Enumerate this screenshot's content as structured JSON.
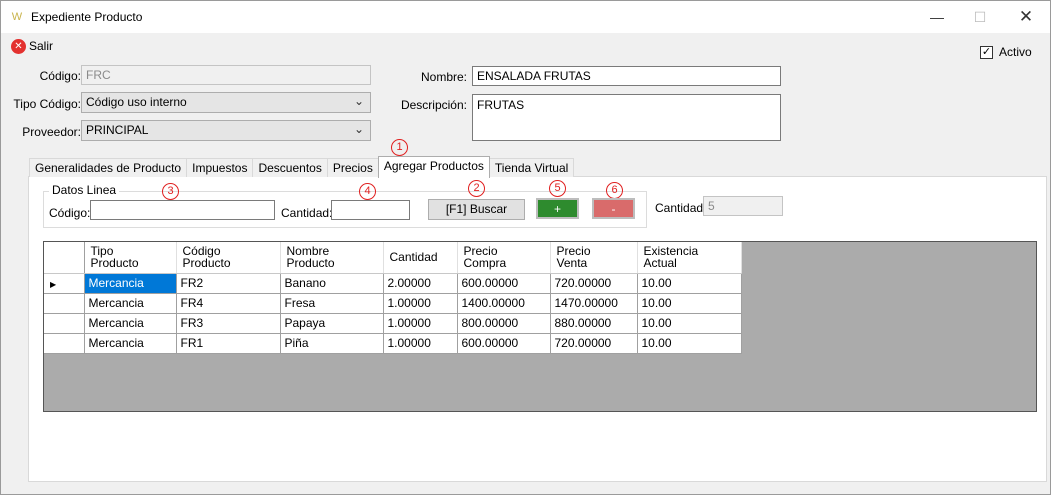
{
  "window": {
    "title": "Expediente Producto"
  },
  "toolbar": {
    "exit_label": "Salir"
  },
  "active": {
    "label": "Activo",
    "checked": true
  },
  "form": {
    "codigo_label": "Código:",
    "codigo_value": "FRC",
    "tipo_codigo_label": "Tipo Código:",
    "tipo_codigo_value": "Código uso interno",
    "proveedor_label": "Proveedor:",
    "proveedor_value": "PRINCIPAL",
    "nombre_label": "Nombre:",
    "nombre_value": "ENSALADA FRUTAS",
    "descripcion_label": "Descripción:",
    "descripcion_value": "FRUTAS"
  },
  "tabs": [
    {
      "label": "Generalidades de Producto"
    },
    {
      "label": "Impuestos"
    },
    {
      "label": "Descuentos"
    },
    {
      "label": "Precios"
    },
    {
      "label": "Agregar Productos"
    },
    {
      "label": "Tienda Virtual"
    }
  ],
  "datos_linea": {
    "title": "Datos Linea",
    "codigo_label": "Código:",
    "cantidad_label": "Cantidad:",
    "buscar_label": "[F1] Buscar",
    "add_label": "+",
    "remove_label": "-",
    "cantidad_total_label": "Cantidad:",
    "cantidad_total_value": "5"
  },
  "callouts": [
    "1",
    "2",
    "3",
    "4",
    "5",
    "6"
  ],
  "grid": {
    "headers": [
      [
        "Tipo",
        "Producto"
      ],
      [
        "Código",
        "Producto"
      ],
      [
        "Nombre",
        "Producto"
      ],
      [
        "Cantidad",
        ""
      ],
      [
        "Precio",
        "Compra"
      ],
      [
        "Precio",
        "Venta"
      ],
      [
        "Existencia",
        "Actual"
      ]
    ],
    "rows": [
      [
        "Mercancia",
        "FR2",
        "Banano",
        "2.00000",
        "600.00000",
        "720.00000",
        "10.00"
      ],
      [
        "Mercancia",
        "FR4",
        "Fresa",
        "1.00000",
        "1400.00000",
        "1470.00000",
        "10.00"
      ],
      [
        "Mercancia",
        "FR3",
        "Papaya",
        "1.00000",
        "800.00000",
        "880.00000",
        "10.00"
      ],
      [
        "Mercancia",
        "FR1",
        "Piña",
        "1.00000",
        "600.00000",
        "720.00000",
        "10.00"
      ]
    ]
  },
  "colors": {
    "selection": "#0078d7",
    "add_button": "#2e8b2e",
    "remove_button": "#d96b6b",
    "callout": "#e02020"
  }
}
